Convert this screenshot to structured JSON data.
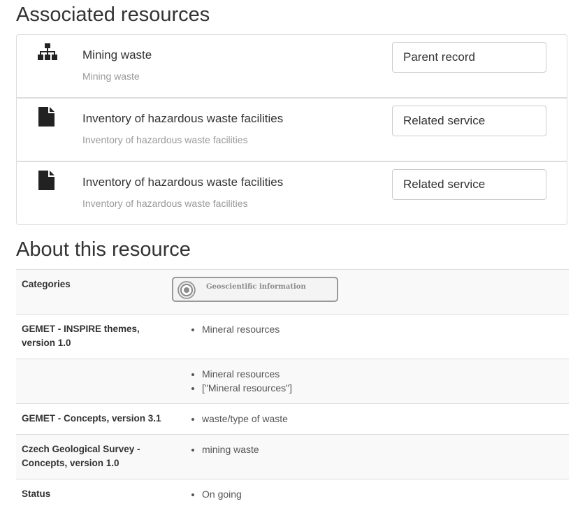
{
  "associated": {
    "heading": "Associated resources",
    "items": [
      {
        "icon": "sitemap-icon",
        "title": "Mining waste",
        "subtitle": "Mining waste",
        "button": "Parent record"
      },
      {
        "icon": "file-icon",
        "title": "Inventory of hazardous waste facilities",
        "subtitle": "Inventory of hazardous waste facilities",
        "button": "Related service"
      },
      {
        "icon": "file-icon",
        "title": "Inventory of hazardous waste facilities",
        "subtitle": "Inventory of hazardous waste facilities",
        "button": "Related service"
      }
    ]
  },
  "about": {
    "heading": "About this resource",
    "rows": [
      {
        "key": "Categories",
        "badge": {
          "icon": "target-icon",
          "label": "Geoscientific information"
        }
      },
      {
        "key": "GEMET - INSPIRE themes, version 1.0",
        "values": [
          "Mineral resources"
        ]
      },
      {
        "key": "",
        "values": [
          "Mineral resources",
          "[\"Mineral resources\"]"
        ]
      },
      {
        "key": "GEMET - Concepts, version 3.1",
        "values": [
          "waste/type of waste"
        ]
      },
      {
        "key": "Czech Geological Survey - Concepts, version 1.0",
        "values": [
          "mining waste"
        ]
      },
      {
        "key": "Status",
        "values": [
          "On going"
        ]
      }
    ]
  }
}
